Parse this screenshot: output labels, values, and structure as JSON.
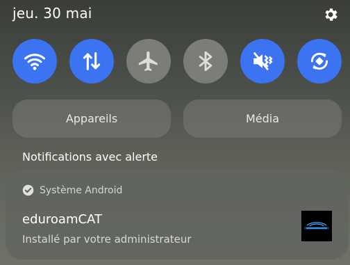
{
  "header": {
    "date": "jeu. 30 mai"
  },
  "quick_settings": {
    "toggles": [
      {
        "icon": "wifi-icon",
        "active": true
      },
      {
        "icon": "mobile-data-icon",
        "active": true
      },
      {
        "icon": "airplane-icon",
        "active": false
      },
      {
        "icon": "bluetooth-icon",
        "active": false
      },
      {
        "icon": "sound-vibrate-icon",
        "active": true
      },
      {
        "icon": "auto-rotate-icon",
        "active": true
      }
    ],
    "devices_label": "Appareils",
    "media_label": "Média"
  },
  "notifications": {
    "section_title": "Notifications avec alerte",
    "items": [
      {
        "app": "Système Android",
        "title": "eduroamCAT",
        "body": "Installé par votre administrateur",
        "thumbnail_icon": "eduroam-logo-icon"
      }
    ]
  },
  "colors": {
    "active": "#3b73f0",
    "inactive": "#7a7d78",
    "icon_active": "#ffffff",
    "icon_inactive": "#c9cbc7"
  }
}
